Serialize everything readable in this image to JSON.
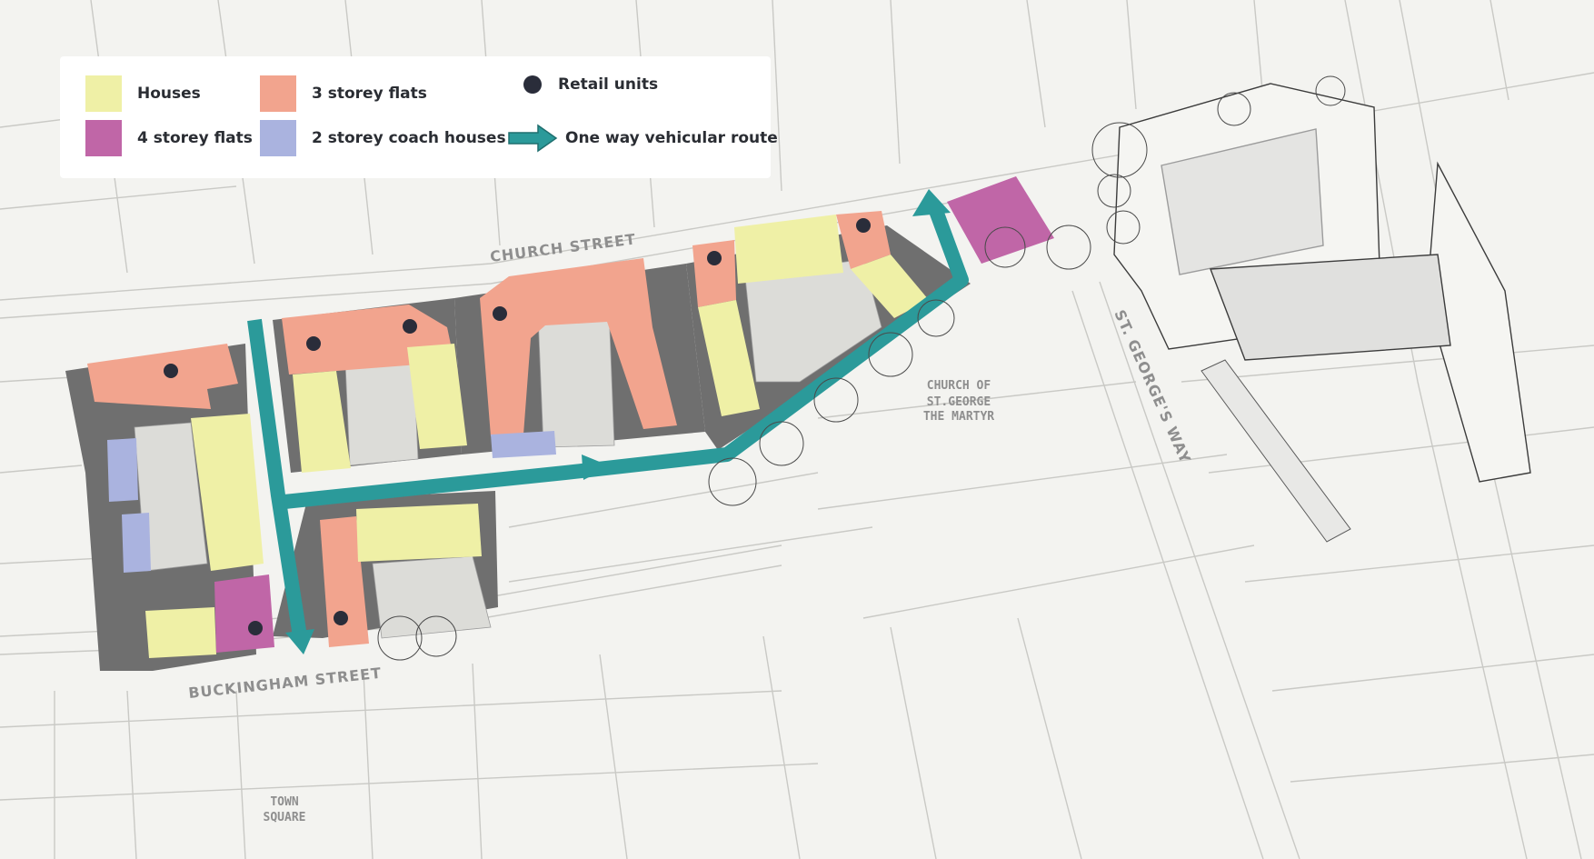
{
  "legend": {
    "items": [
      {
        "label": "Houses",
        "color": "#eff0a6",
        "kind": "swatch"
      },
      {
        "label": "4 storey flats",
        "color": "#c066a7",
        "kind": "swatch"
      },
      {
        "label": "3 storey flats",
        "color": "#f2a48e",
        "kind": "swatch"
      },
      {
        "label": "2 storey coach houses",
        "color": "#aab3df",
        "kind": "swatch"
      },
      {
        "label": "Retail units",
        "color": "#2a2d3a",
        "kind": "dot"
      },
      {
        "label": "One way vehicular route",
        "color": "#2b9a9a",
        "kind": "arrow"
      }
    ]
  },
  "streets": {
    "church": "CHURCH STREET",
    "buckingham": "BUCKINGHAM STREET",
    "st_georges": "ST. GEORGE'S WAY"
  },
  "places": {
    "church": [
      "CHURCH OF",
      "ST.GEORGE",
      "THE MARTYR"
    ],
    "town_square": [
      "TOWN",
      "SQUARE"
    ]
  },
  "colors": {
    "background": "#f3f3f0",
    "street_lines": "#c9c9c5",
    "paving": "#6f6f6f",
    "route": "#2b9a9a"
  }
}
